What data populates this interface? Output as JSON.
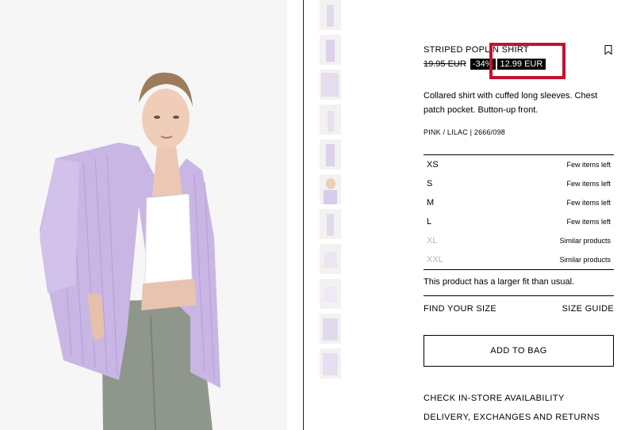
{
  "product": {
    "title": "STRIPED POPLIN SHIRT",
    "old_price": "19.95 EUR",
    "discount": "-34%",
    "new_price": "12.99 EUR",
    "description": "Collared shirt with cuffed long sleeves. Chest patch pocket. Button-up front.",
    "color_ref": "PINK / LILAC | 2666/098"
  },
  "sizes": [
    {
      "name": "XS",
      "status": "Few items left"
    },
    {
      "name": "S",
      "status": "Few items left"
    },
    {
      "name": "M",
      "status": "Few items left"
    },
    {
      "name": "L",
      "status": "Few items left"
    },
    {
      "name": "XL",
      "status": "Similar products"
    },
    {
      "name": "XXL",
      "status": "Similar products"
    }
  ],
  "fit_note": "This product has a larger fit than usual.",
  "links": {
    "find_size": "FIND YOUR SIZE",
    "size_guide": "SIZE GUIDE",
    "add_to_bag": "ADD TO BAG",
    "store_availability": "CHECK IN-STORE AVAILABILITY",
    "delivery": "DELIVERY, EXCHANGES AND RETURNS"
  },
  "icons": {
    "bookmark": "bookmark-icon"
  },
  "colors": {
    "accent_highlight": "#c8102e",
    "shirt": "#c9b6e4",
    "jeans": "#8e9488"
  }
}
